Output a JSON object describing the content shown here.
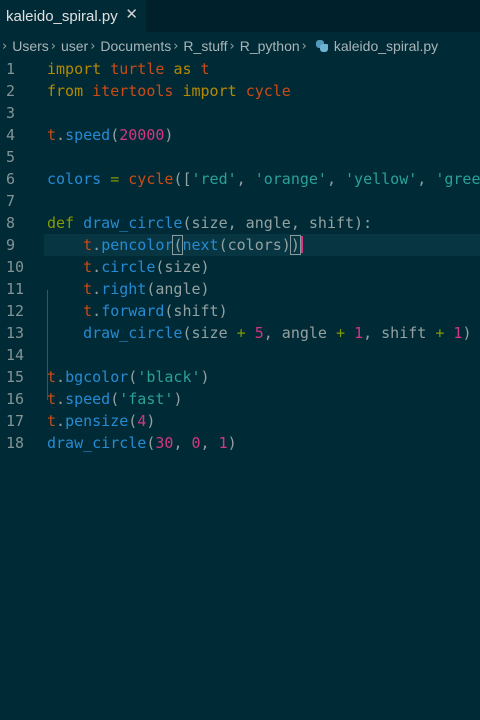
{
  "tab": {
    "label": "kaleido_spiral.py",
    "close_glyph": "✕"
  },
  "breadcrumb": {
    "items": [
      "Users",
      "user",
      "Documents",
      "R_stuff",
      "R_python",
      "kaleido_spiral.py"
    ],
    "separator": "›",
    "file_icon": "python-file-icon"
  },
  "editor": {
    "line_numbers": [
      "1",
      "2",
      "3",
      "4",
      "5",
      "6",
      "7",
      "8",
      "9",
      "10",
      "11",
      "12",
      "13",
      "14",
      "15",
      "16",
      "17",
      "18"
    ],
    "lines": [
      {
        "t": [
          [
            "kw",
            "import"
          ],
          [
            "plain",
            " "
          ],
          [
            "mod",
            "turtle"
          ],
          [
            "plain",
            " "
          ],
          [
            "kw",
            "as"
          ],
          [
            "plain",
            " "
          ],
          [
            "mod",
            "t"
          ]
        ]
      },
      {
        "t": [
          [
            "kw",
            "from"
          ],
          [
            "plain",
            " "
          ],
          [
            "mod",
            "itertools"
          ],
          [
            "plain",
            " "
          ],
          [
            "kw",
            "import"
          ],
          [
            "plain",
            " "
          ],
          [
            "mod",
            "cycle"
          ]
        ]
      },
      {
        "t": []
      },
      {
        "t": [
          [
            "mod",
            "t"
          ],
          [
            "plain",
            "."
          ],
          [
            "fn",
            "speed"
          ],
          [
            "plain",
            "("
          ],
          [
            "num",
            "20000"
          ],
          [
            "plain",
            ")"
          ]
        ]
      },
      {
        "t": []
      },
      {
        "t": [
          [
            "fn",
            "colors"
          ],
          [
            "plain",
            " "
          ],
          [
            "op",
            "="
          ],
          [
            "plain",
            " "
          ],
          [
            "mod",
            "cycle"
          ],
          [
            "plain",
            "(["
          ],
          [
            "str",
            "'red'"
          ],
          [
            "plain",
            ", "
          ],
          [
            "str",
            "'orange'"
          ],
          [
            "plain",
            ", "
          ],
          [
            "str",
            "'yellow'"
          ],
          [
            "plain",
            ", "
          ],
          [
            "str",
            "'green"
          ]
        ]
      },
      {
        "t": []
      },
      {
        "t": [
          [
            "kwb",
            "def"
          ],
          [
            "plain",
            " "
          ],
          [
            "fn",
            "draw_circle"
          ],
          [
            "plain",
            "(size, angle, shift):"
          ]
        ]
      },
      {
        "t": [
          [
            "plain",
            "    "
          ],
          [
            "mod",
            "t"
          ],
          [
            "plain",
            "."
          ],
          [
            "fn",
            "pencolor"
          ],
          [
            "bracket",
            "("
          ],
          [
            "fn",
            "next"
          ],
          [
            "plain",
            "(colors)"
          ],
          [
            "bracket",
            ")"
          ],
          [
            "cursor",
            ""
          ]
        ],
        "active": true
      },
      {
        "t": [
          [
            "plain",
            "    "
          ],
          [
            "mod",
            "t"
          ],
          [
            "plain",
            "."
          ],
          [
            "fn",
            "circle"
          ],
          [
            "plain",
            "(size)"
          ]
        ]
      },
      {
        "t": [
          [
            "plain",
            "    "
          ],
          [
            "mod",
            "t"
          ],
          [
            "plain",
            "."
          ],
          [
            "fn",
            "right"
          ],
          [
            "plain",
            "(angle)"
          ]
        ]
      },
      {
        "t": [
          [
            "plain",
            "    "
          ],
          [
            "mod",
            "t"
          ],
          [
            "plain",
            "."
          ],
          [
            "fn",
            "forward"
          ],
          [
            "plain",
            "(shift)"
          ]
        ]
      },
      {
        "t": [
          [
            "plain",
            "    "
          ],
          [
            "fn",
            "draw_circle"
          ],
          [
            "plain",
            "(size "
          ],
          [
            "op",
            "+"
          ],
          [
            "plain",
            " "
          ],
          [
            "num",
            "5"
          ],
          [
            "plain",
            ", angle "
          ],
          [
            "op",
            "+"
          ],
          [
            "plain",
            " "
          ],
          [
            "num",
            "1"
          ],
          [
            "plain",
            ", shift "
          ],
          [
            "op",
            "+"
          ],
          [
            "plain",
            " "
          ],
          [
            "num",
            "1"
          ],
          [
            "plain",
            ")"
          ]
        ]
      },
      {
        "t": []
      },
      {
        "t": [
          [
            "mod",
            "t"
          ],
          [
            "plain",
            "."
          ],
          [
            "fn",
            "bgcolor"
          ],
          [
            "plain",
            "("
          ],
          [
            "str",
            "'black'"
          ],
          [
            "plain",
            ")"
          ]
        ]
      },
      {
        "t": [
          [
            "mod",
            "t"
          ],
          [
            "plain",
            "."
          ],
          [
            "fn",
            "speed"
          ],
          [
            "plain",
            "("
          ],
          [
            "str",
            "'fast'"
          ],
          [
            "plain",
            ")"
          ]
        ]
      },
      {
        "t": [
          [
            "mod",
            "t"
          ],
          [
            "plain",
            "."
          ],
          [
            "fn",
            "pensize"
          ],
          [
            "plain",
            "("
          ],
          [
            "num",
            "4"
          ],
          [
            "plain",
            ")"
          ]
        ]
      },
      {
        "t": [
          [
            "fn",
            "draw_circle"
          ],
          [
            "plain",
            "("
          ],
          [
            "num",
            "30"
          ],
          [
            "plain",
            ", "
          ],
          [
            "num",
            "0"
          ],
          [
            "plain",
            ", "
          ],
          [
            "num",
            "1"
          ],
          [
            "plain",
            ")"
          ]
        ]
      }
    ]
  },
  "colors": {
    "background": "#002b36",
    "tabbar": "#00212b",
    "keyword": "#b58900",
    "def_keyword": "#859900",
    "module": "#cb4b16",
    "function": "#268bd2",
    "number": "#d33682",
    "string": "#2aa198",
    "operator": "#859900"
  }
}
